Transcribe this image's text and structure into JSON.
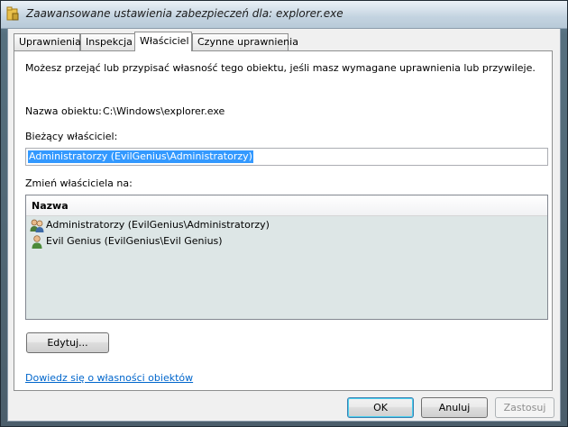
{
  "window": {
    "title": "Zaawansowane ustawienia zabezpieczeń dla: explorer.exe",
    "icon": "folder-lock-icon"
  },
  "tabs": [
    {
      "label": "Uprawnienia",
      "active": false
    },
    {
      "label": "Inspekcja",
      "active": false
    },
    {
      "label": "Właściciel",
      "active": true
    },
    {
      "label": "Czynne uprawnienia",
      "active": false
    }
  ],
  "panel": {
    "description": "Możesz przejąć lub przypisać własność tego obiektu, jeśli masz wymagane uprawnienia lub przywileje.",
    "object_name_label": "Nazwa obiektu:",
    "object_name_value": "C:\\Windows\\explorer.exe",
    "current_owner_label": "Bieżący właściciel:",
    "current_owner_value": "Administratorzy (EvilGenius\\Administratorzy)",
    "change_owner_label": "Zmień właściciela na:",
    "list": {
      "column_header": "Nazwa",
      "items": [
        {
          "label": "Administratorzy (EvilGenius\\Administratorzy)",
          "icon": "user-group-icon"
        },
        {
          "label": "Evil Genius (EvilGenius\\Evil Genius)",
          "icon": "user-icon"
        }
      ]
    },
    "edit_button": "Edytuj...",
    "help_link": "Dowiedz się o własności obiektów"
  },
  "footer": {
    "ok": "OK",
    "cancel": "Anuluj",
    "apply": "Zastosuj"
  }
}
